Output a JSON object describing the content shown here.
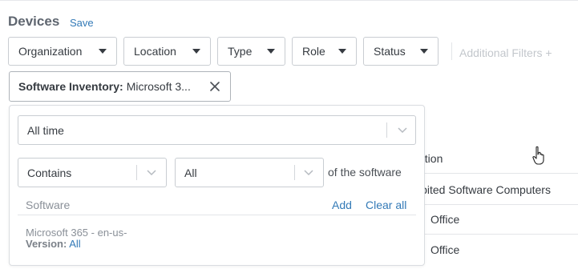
{
  "header": {
    "title": "Devices",
    "save_label": "Save"
  },
  "filters": {
    "organization": "Organization",
    "location": "Location",
    "type": "Type",
    "role": "Role",
    "status": "Status",
    "additional": "Additional Filters +"
  },
  "chip": {
    "name": "Software Inventory:",
    "value": "Microsoft 3..."
  },
  "panel": {
    "time_select": "All time",
    "contains_select": "Contains",
    "all_select": "All",
    "of_the_software": "of the software",
    "software_label": "Software",
    "add_label": "Add",
    "clear_label": "Clear all",
    "item_name": "Microsoft 365 - en-us-",
    "version_label": "Version:",
    "version_value": "All"
  },
  "background_table": {
    "column_header": "ation",
    "rows": [
      "ibited Software Computers",
      "Office",
      "Office"
    ]
  }
}
